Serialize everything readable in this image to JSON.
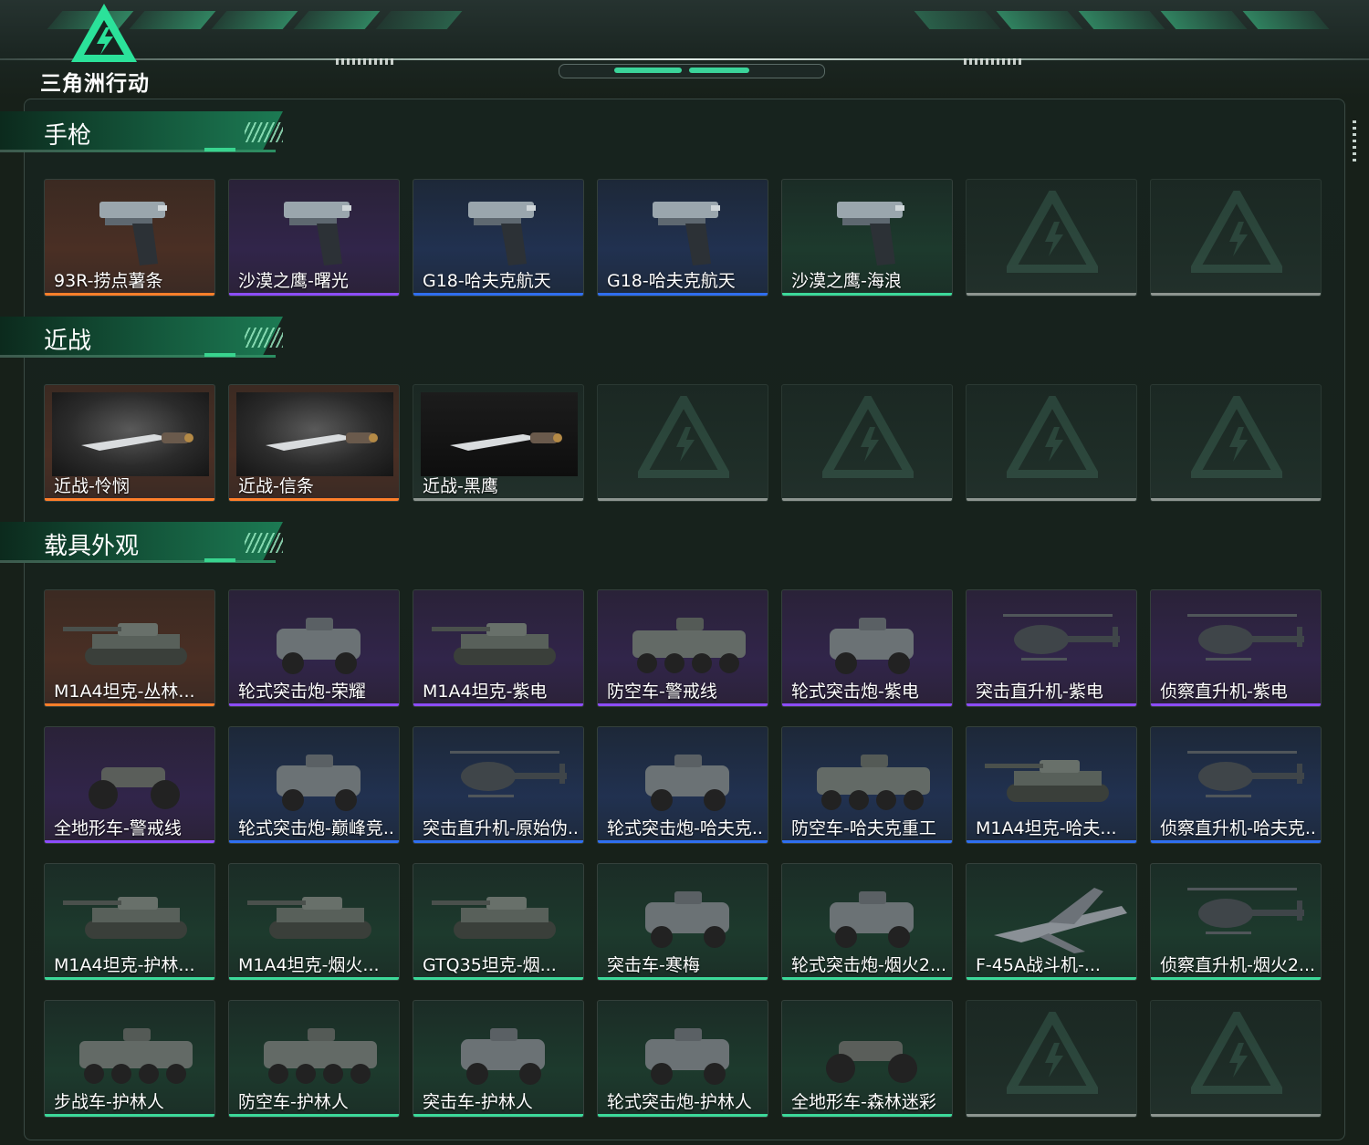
{
  "app": {
    "logo_text": "三角洲行动"
  },
  "sections": [
    {
      "title": "手枪",
      "items": [
        {
          "label": "93R-捞点薯条",
          "rarity": "orange",
          "icon": "pistol-icon"
        },
        {
          "label": "沙漠之鹰-曙光",
          "rarity": "purple",
          "icon": "pistol-icon"
        },
        {
          "label": "G18-哈夫克航天",
          "rarity": "blue",
          "icon": "pistol-icon"
        },
        {
          "label": "G18-哈夫克航天",
          "rarity": "blue",
          "icon": "pistol-icon"
        },
        {
          "label": "沙漠之鹰-海浪",
          "rarity": "green",
          "icon": "pistol-icon"
        },
        {
          "label": "",
          "rarity": "empty",
          "icon": "empty-slot-icon"
        },
        {
          "label": "",
          "rarity": "empty",
          "icon": "empty-slot-icon"
        }
      ]
    },
    {
      "title": "近战",
      "items": [
        {
          "label": "近战-怜悯",
          "rarity": "orange",
          "icon": "knife-icon"
        },
        {
          "label": "近战-信条",
          "rarity": "orange",
          "icon": "knife-icon"
        },
        {
          "label": "近战-黑鹰",
          "rarity": "empty-labeled",
          "icon": "knife-icon"
        },
        {
          "label": "",
          "rarity": "empty",
          "icon": "empty-slot-icon"
        },
        {
          "label": "",
          "rarity": "empty",
          "icon": "empty-slot-icon"
        },
        {
          "label": "",
          "rarity": "empty",
          "icon": "empty-slot-icon"
        },
        {
          "label": "",
          "rarity": "empty",
          "icon": "empty-slot-icon"
        }
      ]
    },
    {
      "title": "载具外观",
      "items": [
        {
          "label": "M1A4坦克-丛林...",
          "rarity": "orange",
          "icon": "tank-icon"
        },
        {
          "label": "轮式突击炮-荣耀",
          "rarity": "purple",
          "icon": "armored-car-icon"
        },
        {
          "label": "M1A4坦克-紫电",
          "rarity": "purple",
          "icon": "tank-icon"
        },
        {
          "label": "防空车-警戒线",
          "rarity": "purple",
          "icon": "apc-icon"
        },
        {
          "label": "轮式突击炮-紫电",
          "rarity": "purple",
          "icon": "armored-car-icon"
        },
        {
          "label": "突击直升机-紫电",
          "rarity": "purple",
          "icon": "helicopter-icon"
        },
        {
          "label": "侦察直升机-紫电",
          "rarity": "purple",
          "icon": "helicopter-icon"
        },
        {
          "label": "全地形车-警戒线",
          "rarity": "purple",
          "icon": "atv-icon"
        },
        {
          "label": "轮式突击炮-巅峰竞...",
          "rarity": "blue",
          "icon": "armored-car-icon"
        },
        {
          "label": "突击直升机-原始伪...",
          "rarity": "blue",
          "icon": "helicopter-icon"
        },
        {
          "label": "轮式突击炮-哈夫克...",
          "rarity": "blue",
          "icon": "armored-car-icon"
        },
        {
          "label": "防空车-哈夫克重工",
          "rarity": "blue",
          "icon": "apc-icon"
        },
        {
          "label": "M1A4坦克-哈夫...",
          "rarity": "blue",
          "icon": "tank-icon"
        },
        {
          "label": "侦察直升机-哈夫克...",
          "rarity": "blue",
          "icon": "helicopter-icon"
        },
        {
          "label": "M1A4坦克-护林...",
          "rarity": "green",
          "icon": "tank-icon"
        },
        {
          "label": "M1A4坦克-烟火...",
          "rarity": "green",
          "icon": "tank-icon"
        },
        {
          "label": "GTQ35坦克-烟...",
          "rarity": "green",
          "icon": "tank-icon"
        },
        {
          "label": "突击车-寒梅",
          "rarity": "green",
          "icon": "armored-car-icon"
        },
        {
          "label": "轮式突击炮-烟火2...",
          "rarity": "green",
          "icon": "armored-car-icon"
        },
        {
          "label": "F-45A战斗机-...",
          "rarity": "green",
          "icon": "jet-icon"
        },
        {
          "label": "侦察直升机-烟火2...",
          "rarity": "green",
          "icon": "helicopter-icon"
        },
        {
          "label": "步战车-护林人",
          "rarity": "green",
          "icon": "apc-icon"
        },
        {
          "label": "防空车-护林人",
          "rarity": "green",
          "icon": "apc-icon"
        },
        {
          "label": "突击车-护林人",
          "rarity": "green",
          "icon": "armored-car-icon"
        },
        {
          "label": "轮式突击炮-护林人",
          "rarity": "green",
          "icon": "armored-car-icon"
        },
        {
          "label": "全地形车-森林迷彩",
          "rarity": "green",
          "icon": "atv-icon"
        },
        {
          "label": "",
          "rarity": "empty",
          "icon": "empty-slot-icon"
        },
        {
          "label": "",
          "rarity": "empty",
          "icon": "empty-slot-icon"
        }
      ]
    }
  ],
  "colors": {
    "orange": "#ff7f2a",
    "purple": "#8d4dff",
    "blue": "#2f6ff0",
    "green": "#3cd99a",
    "empty": "#8d9590",
    "accent": "#1ed08a"
  }
}
